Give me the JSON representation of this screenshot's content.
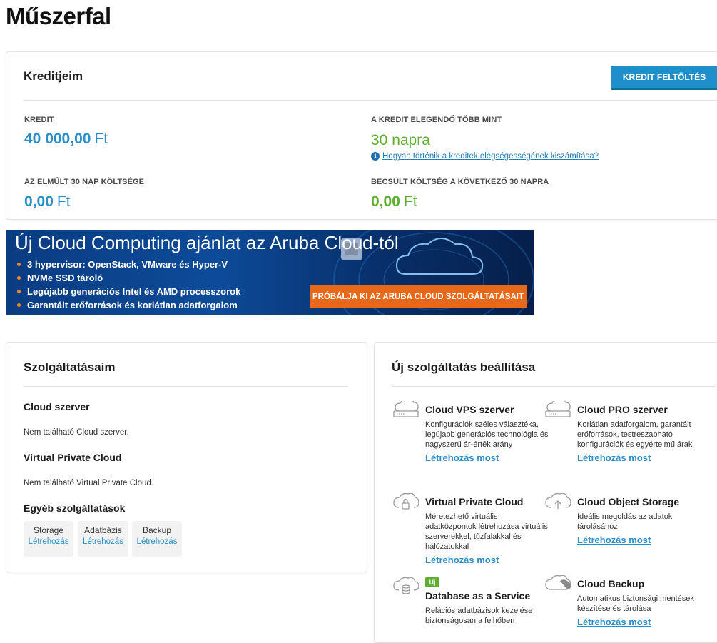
{
  "page": {
    "title": "Műszerfal"
  },
  "credits": {
    "title": "Kreditjeim",
    "topup_label": "KREDIT FELTÖLTÉS",
    "credit_label": "KREDIT",
    "credit_value": "40 000,00",
    "currency": "Ft",
    "enough_label": "A KREDIT ELEGENDŐ TÖBB MINT",
    "enough_value": "30 napra",
    "info_link": "Hogyan történik a kreditek elégségességének kiszámítása?",
    "past_cost_label": "AZ ELMÚLT 30 NAP KÖLTSÉGE",
    "past_cost_value": "0,00",
    "forecast_label": "BECSÜLT KÖLTSÉG A KÖVETKEZŐ 30 NAPRA",
    "forecast_value": "0,00"
  },
  "banner": {
    "title": "Új Cloud Computing ajánlat az Aruba Cloud-tól",
    "bullets": [
      "3 hypervisor: OpenStack, VMware és Hyper-V",
      "NVMe SSD tároló",
      "Legújabb generációs Intel és AMD processzorok",
      "Garantált erőforrások és korlátlan adatforgalom"
    ],
    "cta": "PRÓBÁLJA KI AZ ARUBA CLOUD SZOLGÁLTATÁSAIT"
  },
  "my_services": {
    "title": "Szolgáltatásaim",
    "cloud_server_head": "Cloud szerver",
    "cloud_server_empty": "Nem található Cloud szerver.",
    "vpc_head": "Virtual Private Cloud",
    "vpc_empty": "Nem található Virtual Private Cloud.",
    "other_head": "Egyéb szolgáltatások",
    "chips": [
      {
        "name": "Storage",
        "link": "Létrehozás"
      },
      {
        "name": "Adatbázis",
        "link": "Létrehozás"
      },
      {
        "name": "Backup",
        "link": "Létrehozás"
      }
    ]
  },
  "new_service": {
    "title": "Új szolgáltatás beállítása",
    "create_label": "Létrehozás most",
    "new_badge": "Új",
    "items": [
      {
        "title": "Cloud VPS szerver",
        "desc": "Konfigurációk széles választéka, legújabb generációs technológia és nagyszerű ár-érték arány",
        "icon": "server-cloud-icon"
      },
      {
        "title": "Cloud PRO szerver",
        "desc": "Korlátlan adatforgalom, garantált erőforrások, testreszabható konfigurációk és egyértelmű árak",
        "icon": "server-cloud-icon"
      },
      {
        "title": "Virtual Private Cloud",
        "desc": "Méretezhető virtuális adatközpontok létrehozása virtuális szerverekkel, tűzfalakkal és hálózatokkal",
        "icon": "cloud-lock-icon"
      },
      {
        "title": "Cloud Object Storage",
        "desc": "Ideális megoldás az adatok tárolásához",
        "icon": "cloud-upload-icon"
      },
      {
        "title": "Database as a Service",
        "desc": "Relációs adatbázisok kezelése biztonságosan a felhőben",
        "icon": "cloud-database-icon"
      },
      {
        "title": "Cloud Backup",
        "desc": "Automatikus biztonsági mentések készítése és tárolása",
        "icon": "cloud-backup-icon"
      }
    ]
  }
}
